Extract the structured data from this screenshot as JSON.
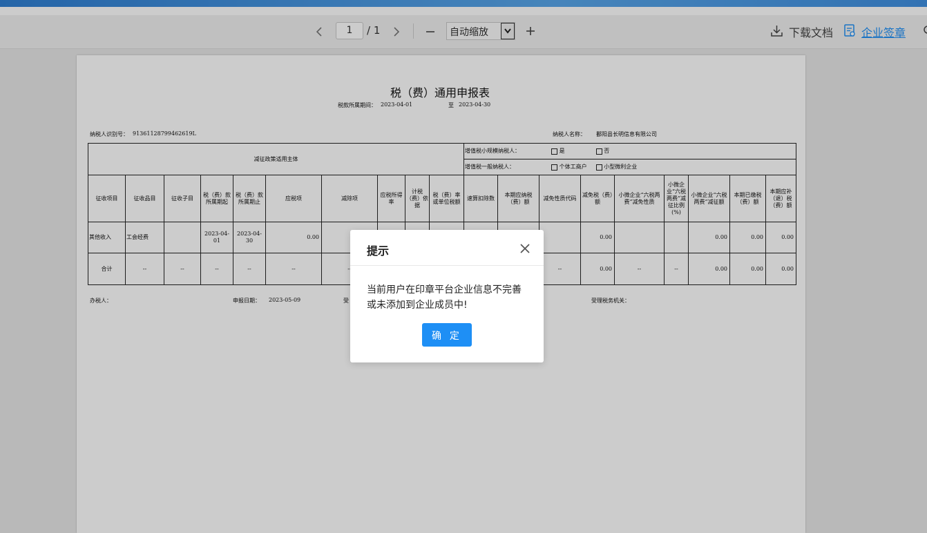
{
  "toolbar": {
    "current_page": "1",
    "total_pages": "/ 1",
    "zoom_selected": "自动缩放",
    "download_label": "下载文档",
    "sign_label": "企业签章",
    "accent_color": "#1e8ff5"
  },
  "document": {
    "title": "税（费）通用申报表",
    "period_label": "税款所属期间：",
    "period_start": "2023-04-01",
    "period_to": "至",
    "period_end": "2023-04-30",
    "taxpayer_id_label": "纳税人识别号：",
    "taxpayer_id": "91361128799462619L",
    "taxpayer_name_label": "纳税人名称：",
    "taxpayer_name": "鄱阳县长明信息有限公司",
    "policy_subject": "减征政策适用主体",
    "vat_small_label": "增值税小规模纳税人：",
    "yes": "是",
    "no": "否",
    "vat_general_label": "增值税一般纳税人：",
    "individual": "个体工商户",
    "small_micro": "小型微利企业",
    "headers": [
      "征收项目",
      "征收品目",
      "征收子目",
      "税（费）款所属期起",
      "税（费）款所属期止",
      "应税项",
      "减除项",
      "应税所得率",
      "计税（费）依据",
      "税（费）率或单位税额",
      "速算扣除数",
      "本期应纳税（费）额",
      "减免性质代码",
      "减免税（费）额",
      "小微企业“六税两费”减免性质",
      "小微企业“六税两费”减征比例(%)",
      "小微企业“六税两费”减征额",
      "本期已缴税（费）额",
      "本期应补（退）税（费）额"
    ],
    "row1": {
      "project": "其他收入",
      "item": "工会经费",
      "start": "2023-04-01",
      "end": "2023-04-30",
      "taxable": "0.00",
      "relief": "0.00",
      "six_relief": "0.00",
      "paid": "0.00",
      "due": "0.00"
    },
    "total_row": {
      "label": "合计",
      "dash": "--",
      "relief": "0.00",
      "six_relief": "0.00",
      "paid": "0.00",
      "due": "0.00"
    },
    "agent_label": "办税人：",
    "report_date_label": "申报日期：",
    "report_date": "2023-05-09",
    "accept_partial": "受",
    "accept_org_label": "受理税务机关："
  },
  "dialog": {
    "title": "提示",
    "message": "当前用户在印章平台企业信息不完善或未添加到企业成员中!",
    "confirm": "确 定"
  }
}
